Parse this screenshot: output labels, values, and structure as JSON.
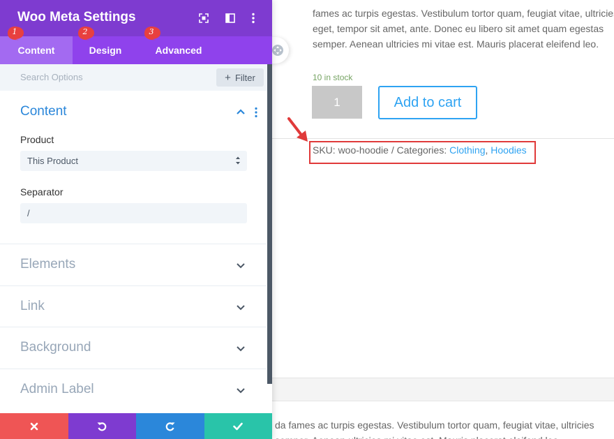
{
  "panel": {
    "title": "Woo Meta Settings",
    "tabs": [
      {
        "label": "Content",
        "badge": "1",
        "active": true
      },
      {
        "label": "Design",
        "badge": "2",
        "active": false
      },
      {
        "label": "Advanced",
        "badge": "3",
        "active": false
      }
    ],
    "search_placeholder": "Search Options",
    "filter_label": "Filter",
    "content_section": {
      "title": "Content",
      "product_label": "Product",
      "product_value": "This Product",
      "separator_label": "Separator",
      "separator_value": "/"
    },
    "collapsed_sections": [
      "Elements",
      "Link",
      "Background",
      "Admin Label"
    ],
    "footer_icons": [
      "close-icon",
      "undo-icon",
      "redo-icon",
      "check-icon"
    ],
    "colors": {
      "header": "#7e3bd0",
      "tabs": "#8f42ec",
      "active_tab": "#a36af1",
      "accent_blue": "#2b87da",
      "cancel": "#ef5555",
      "undo": "#7e3bd0",
      "redo": "#2b87da",
      "save": "#29c4a9"
    }
  },
  "page": {
    "description_lines": [
      "fames ac turpis egestas. Vestibulum tortor quam, feugiat vitae, ultricies",
      "eget, tempor sit amet, ante. Donec eu libero sit amet quam egestas",
      "semper. Aenean ultricies mi vitae est. Mauris placerat eleifend leo."
    ],
    "stock": "10 in stock",
    "quantity": "1",
    "add_to_cart": "Add to cart",
    "meta": {
      "sku_prefix": "SKU: woo-hoodie / Categories: ",
      "cat1": "Clothing",
      "comma": ", ",
      "cat2": "Hoodies"
    },
    "bottom_lines": [
      "da fames ac turpis egestas. Vestibulum tortor quam, feugiat vitae, ultricies",
      "semper. Aenean ultricies mi vitae est. Mauris placerat eleifend leo."
    ]
  }
}
